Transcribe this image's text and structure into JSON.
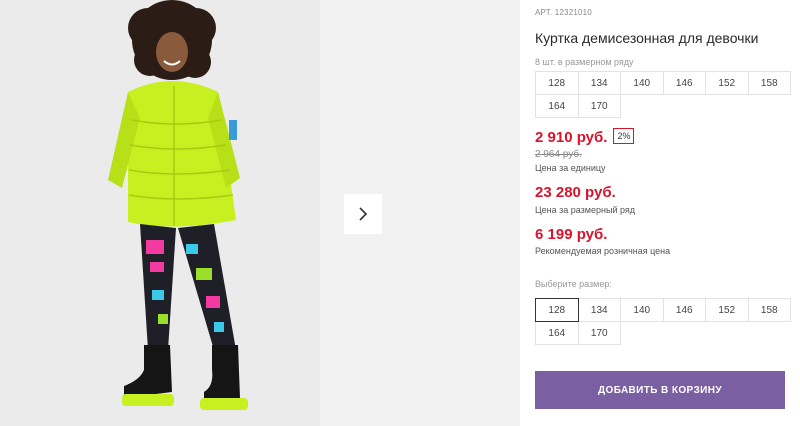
{
  "product": {
    "article": "АРТ. 12321010",
    "title": "Куртка демисезонная для девочки"
  },
  "size_row": {
    "label": "8 шт. в размерном ряду",
    "sizes": [
      "128",
      "134",
      "140",
      "146",
      "152",
      "158",
      "164",
      "170"
    ]
  },
  "pricing": {
    "unit_price": "2 910 руб.",
    "discount": "2%",
    "old_price": "2 964 руб.",
    "unit_price_note": "Цена за единицу",
    "row_price": "23 280 руб.",
    "row_price_note": "Цена за размерный ряд",
    "retail_price": "6 199 руб.",
    "retail_price_note": "Рекомендуемая розничная цена"
  },
  "size_select": {
    "label": "Выберите размер:",
    "sizes": [
      "128",
      "134",
      "140",
      "146",
      "152",
      "158",
      "164",
      "170"
    ],
    "selected": "128"
  },
  "actions": {
    "add_to_cart": "ДОБАВИТЬ В КОРЗИНУ"
  },
  "colors": {
    "accent_purple": "#7b5fa3",
    "price_red": "#d8132b",
    "jacket_lime": "#c8f020"
  }
}
